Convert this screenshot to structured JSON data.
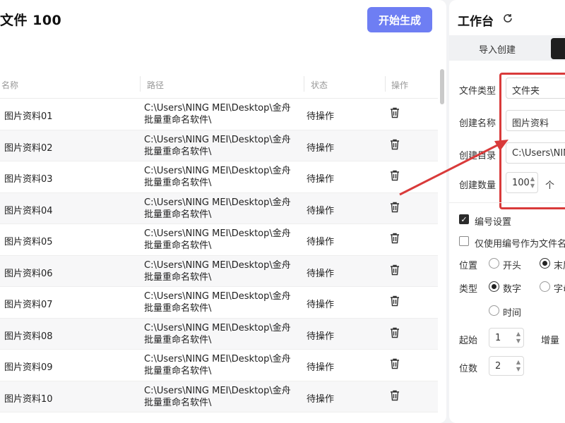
{
  "left": {
    "title": "文件 100",
    "generate_button": "开始生成",
    "columns": {
      "name": "名称",
      "path": "路径",
      "status": "状态",
      "action": "操作"
    },
    "rows": [
      {
        "name": "图片资料01",
        "path_line1": "C:\\Users\\NING MEI\\Desktop\\金舟",
        "path_line2": "批量重命名软件\\",
        "status": "待操作"
      },
      {
        "name": "图片资料02",
        "path_line1": "C:\\Users\\NING MEI\\Desktop\\金舟",
        "path_line2": "批量重命名软件\\",
        "status": "待操作"
      },
      {
        "name": "图片资料03",
        "path_line1": "C:\\Users\\NING MEI\\Desktop\\金舟",
        "path_line2": "批量重命名软件\\",
        "status": "待操作"
      },
      {
        "name": "图片资料04",
        "path_line1": "C:\\Users\\NING MEI\\Desktop\\金舟",
        "path_line2": "批量重命名软件\\",
        "status": "待操作"
      },
      {
        "name": "图片资料05",
        "path_line1": "C:\\Users\\NING MEI\\Desktop\\金舟",
        "path_line2": "批量重命名软件\\",
        "status": "待操作"
      },
      {
        "name": "图片资料06",
        "path_line1": "C:\\Users\\NING MEI\\Desktop\\金舟",
        "path_line2": "批量重命名软件\\",
        "status": "待操作"
      },
      {
        "name": "图片资料07",
        "path_line1": "C:\\Users\\NING MEI\\Desktop\\金舟",
        "path_line2": "批量重命名软件\\",
        "status": "待操作"
      },
      {
        "name": "图片资料08",
        "path_line1": "C:\\Users\\NING MEI\\Desktop\\金舟",
        "path_line2": "批量重命名软件\\",
        "status": "待操作"
      },
      {
        "name": "图片资料09",
        "path_line1": "C:\\Users\\NING MEI\\Desktop\\金舟",
        "path_line2": "批量重命名软件\\",
        "status": "待操作"
      },
      {
        "name": "图片资料10",
        "path_line1": "C:\\Users\\NING MEI\\Desktop\\金舟",
        "path_line2": "批量重命名软件\\",
        "status": "待操作"
      }
    ]
  },
  "right": {
    "title": "工作台",
    "tab_import": "导入创建",
    "file_type_label": "文件类型",
    "file_type_value": "文件夹",
    "create_name_label": "创建名称",
    "create_name_value": "图片资料",
    "create_dir_label": "创建目录",
    "create_dir_value": "C:\\Users\\NING",
    "create_count_label": "创建数量",
    "create_count_value": "100",
    "create_count_unit": "个",
    "numbering_settings": "编号设置",
    "numbering_only": "仅使用编号作为文件名",
    "position_label": "位置",
    "position_start": "开头",
    "position_end": "末尾",
    "type_label": "类型",
    "type_number": "数字",
    "type_letter": "字母",
    "type_time": "时间",
    "start_label": "起始",
    "start_value": "1",
    "increment_label": "增量",
    "digits_label": "位数",
    "digits_value": "2"
  },
  "colors": {
    "accent": "#6e7ef3",
    "highlight_red": "#d93a3a"
  },
  "icons": {
    "row_action": "trash-icon",
    "refresh": "refresh-icon",
    "annotation": "arrow-annotation"
  }
}
